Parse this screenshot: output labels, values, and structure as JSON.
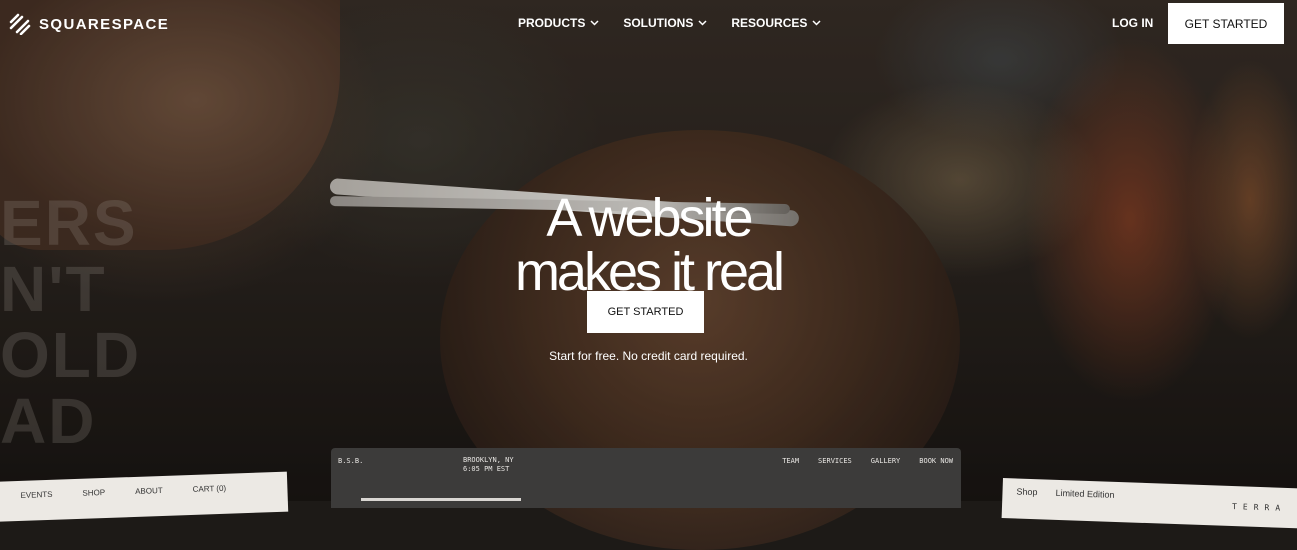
{
  "header": {
    "logo_text": "SQUARESPACE",
    "menu": [
      {
        "label": "PRODUCTS"
      },
      {
        "label": "SOLUTIONS"
      },
      {
        "label": "RESOURCES"
      }
    ],
    "login_label": "LOG IN",
    "cta_label": "GET STARTED"
  },
  "hero": {
    "title_line1": "A website",
    "title_line2": "makes it real",
    "cta_label": "GET STARTED",
    "subtext": "Start for free. No credit card required."
  },
  "background_wall_text": [
    "ERS",
    "N'T",
    "OLD",
    "AD"
  ],
  "preview_center": {
    "brand": "B.S.B.",
    "location": "BROOKLYN, NY",
    "time": "6:05 PM EST",
    "links": [
      "TEAM",
      "SERVICES",
      "GALLERY",
      "BOOK NOW"
    ]
  },
  "preview_left": {
    "links": [
      "EVENTS",
      "SHOP",
      "ABOUT",
      "CART (0)"
    ]
  },
  "preview_right": {
    "links": [
      "Shop",
      "Limited Edition"
    ],
    "brand": "TERRA"
  },
  "colors": {
    "cta_bg": "#ffffff",
    "cta_text": "#111111",
    "nav_text": "#ffffff"
  }
}
